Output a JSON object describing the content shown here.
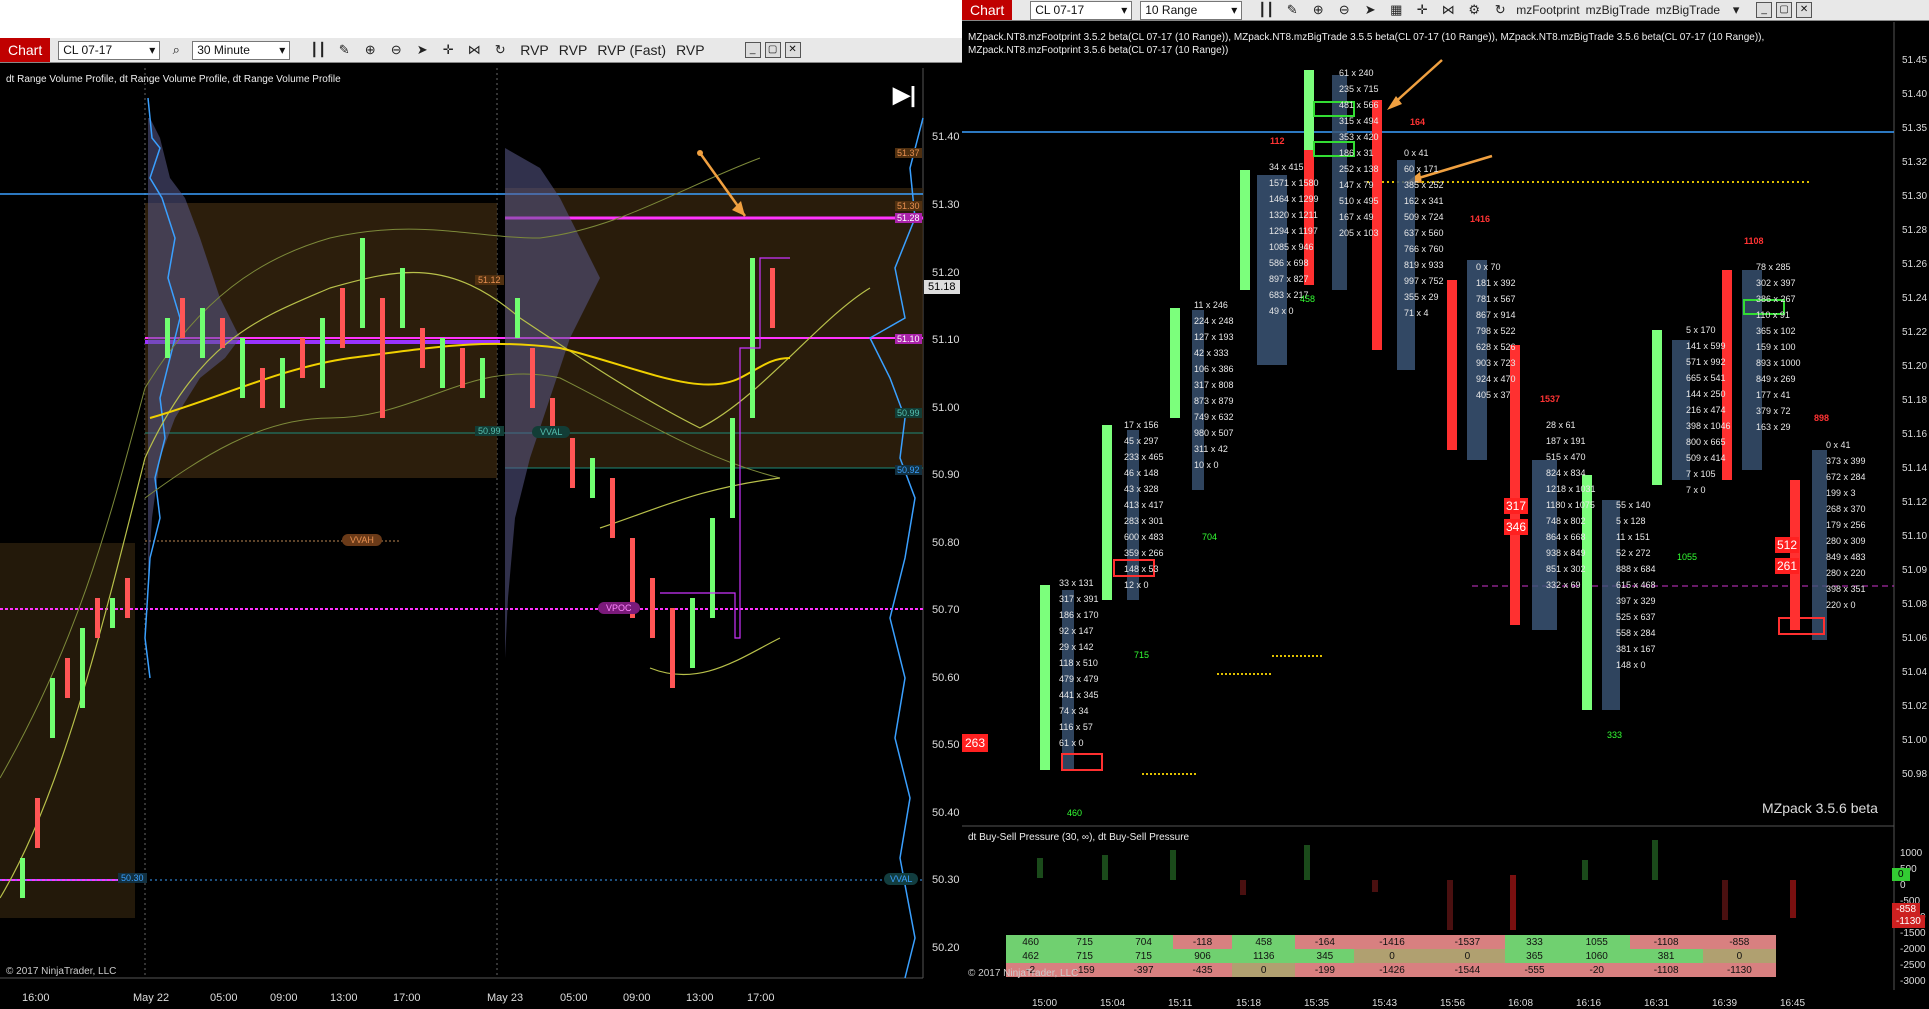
{
  "left": {
    "toolbar": {
      "title": "Chart",
      "instrument": "CL 07-17",
      "interval": "30 Minute",
      "labels": [
        "RVP",
        "RVP",
        "RVP  (Fast)",
        "RVP"
      ]
    },
    "indicator_label": "dt Range Volume Profile, dt Range Volume Profile, dt Range Volume Profile",
    "copyright": "© 2017 NinjaTrader, LLC",
    "price_axis": [
      "51.40",
      "51.30",
      "51.20",
      "51.10",
      "51.00",
      "50.90",
      "50.80",
      "50.70",
      "50.60",
      "50.50",
      "50.40",
      "50.30",
      "50.20"
    ],
    "time_axis": [
      "16:00",
      "May 22",
      "05:00",
      "09:00",
      "13:00",
      "17:00",
      "May 23",
      "05:00",
      "09:00",
      "13:00",
      "17:00"
    ],
    "markers": {
      "vvah": "VVAH",
      "vpoc": "VPOC",
      "vval": "VVAL",
      "vval2": "VVAL",
      "current": "51.18",
      "tag_1137": "51.37",
      "tag_5130": "51.30",
      "tag_5128": "51.28",
      "tag_5110": "51.10",
      "tag_5099": "50.99",
      "tag_5092": "50.92",
      "tag_5099b": "50.99",
      "tag_5030": "50.30",
      "tag_5112": "51.12"
    },
    "colors": {
      "magenta": "#ff33ff",
      "accent_blue": "#3aa0ff",
      "poc_purple": "#9933ff"
    }
  },
  "right": {
    "toolbar": {
      "title": "Chart",
      "instrument": "CL 07-17",
      "interval": "10 Range",
      "labels": [
        "mzFootprint",
        "mzBigTrade",
        "mzBigTrade"
      ]
    },
    "indicator_line1": "MZpack.NT8.mzFootprint 3.5.2 beta(CL 07-17 (10 Range)), MZpack.NT8.mzBigTrade 3.5.5 beta(CL 07-17 (10 Range)), MZpack.NT8.mzBigTrade 3.5.6 beta(CL 07-17 (10 Range)),",
    "indicator_line2": "MZpack.NT8.mzFootprint 3.5.6 beta(CL 07-17 (10 Range))",
    "watermark": "MZpack 3.5.6 beta",
    "sub_label": "dt Buy-Sell Pressure (30, ∞), dt Buy-Sell Pressure",
    "copyright": "© 2017 NinjaTrader, LLC",
    "price_axis": [
      "51.45",
      "51.40",
      "51.35",
      "51.32",
      "51.30",
      "51.28",
      "51.26",
      "51.24",
      "51.22",
      "51.20",
      "51.18",
      "51.16",
      "51.14",
      "51.12",
      "51.10",
      "51.09",
      "51.08",
      "51.06",
      "51.04",
      "51.02",
      "51.00",
      "50.98"
    ],
    "sub_axis": [
      "1000",
      "500",
      "0",
      "-500",
      "-1000",
      "-1500",
      "-2000",
      "-2500",
      "-3000"
    ],
    "sub_tags": {
      "green": "0",
      "red1": "-858",
      "red2": "-1130"
    },
    "time_axis": [
      "15:00",
      "15:04",
      "15:11",
      "15:18",
      "15:35",
      "15:43",
      "15:56",
      "16:08",
      "16:16",
      "16:31",
      "16:39",
      "16:45"
    ],
    "left_badge": "263",
    "delta_row1": [
      "460",
      "715",
      "704",
      "-118",
      "458",
      "-164",
      "-1416",
      "-1537",
      "333",
      "1055",
      "-1108",
      "-858"
    ],
    "delta_row2": [
      "462",
      "715",
      "715",
      "906",
      "1136",
      "345",
      "0",
      "0",
      "365",
      "1060",
      "381",
      "0"
    ],
    "delta_row3": [
      "-2",
      "-159",
      "-397",
      "-435",
      "0",
      "-199",
      "-1426",
      "-1544",
      "-555",
      "-20",
      "-1108",
      "-1130"
    ],
    "bar_deltas": [
      "460",
      "715",
      "704",
      "458",
      "333",
      "1055"
    ],
    "red_deltas": [
      "112",
      "164",
      "1416",
      "1537",
      "1108",
      "898"
    ],
    "big_labels": [
      "317",
      "346",
      "512",
      "261"
    ],
    "columns": [
      {
        "cells": [
          "33 x 131",
          "317 x 391",
          "186 x 170",
          "92 x 147",
          "29 x 142",
          "118 x 510",
          "479 x 479",
          "441 x 345",
          "74 x 34",
          "116 x 57",
          "61 x 0"
        ]
      },
      {
        "cells": [
          "17 x 156",
          "45 x 297",
          "233 x 465",
          "46 x 148",
          "43 x 328",
          "413 x 417",
          "283 x 301",
          "600 x 483",
          "359 x 266",
          "148 x 53",
          "12 x 0"
        ]
      },
      {
        "cells": [
          "11 x 246",
          "224 x 248",
          "127 x 193",
          "42 x 333",
          "106 x 386",
          "317 x 808",
          "873 x 879",
          "749 x 632",
          "980 x 507",
          "311 x 42",
          "10 x 0"
        ]
      },
      {
        "cells": [
          "34 x 415",
          "1571 x 1580",
          "1464 x 1299",
          "1320 x 1211",
          "1294 x 1197",
          "1085 x 946",
          "586 x 698",
          "897 x 827",
          "683 x 217",
          "49 x 0"
        ]
      },
      {
        "cells": [
          "61 x 240",
          "235 x 715",
          "481 x 566",
          "315 x 494",
          "353 x 420",
          "186 x 31",
          "252 x 138",
          "147 x 79",
          "510 x 495",
          "167 x 49",
          "205 x 103"
        ]
      },
      {
        "cells": [
          "0 x 41",
          "60 x 171",
          "385 x 252",
          "162 x 341",
          "509 x 724",
          "637 x 560",
          "766 x 760",
          "819 x 933",
          "997 x 752",
          "355 x 29",
          "71 x 4"
        ]
      },
      {
        "cells": [
          "0 x 70",
          "181 x 392",
          "781 x 567",
          "867 x 914",
          "798 x 522",
          "628 x 526",
          "903 x 723",
          "924 x 470",
          "405 x 37"
        ]
      },
      {
        "cells": [
          "28 x 61",
          "187 x 191",
          "515 x 470",
          "824 x 834",
          "1218 x 1031",
          "1180 x 1075",
          "748 x 802",
          "864 x 668",
          "938 x 849",
          "851 x 302",
          "332 x 69"
        ]
      },
      {
        "cells": [
          "55 x 140",
          "5 x 128",
          "11 x 151",
          "52 x 272",
          "888 x 684",
          "615 x 468",
          "397 x 329",
          "525 x 637",
          "558 x 284",
          "381 x 167",
          "148 x 0"
        ]
      },
      {
        "cells": [
          "5 x 170",
          "141 x 599",
          "571 x 992",
          "665 x 541",
          "144 x 250",
          "216 x 474",
          "398 x 1046",
          "800 x 665",
          "509 x 414",
          "7 x 105",
          "7 x 0"
        ]
      },
      {
        "cells": [
          "78 x 285",
          "302 x 397",
          "386 x 267",
          "110 x 91",
          "365 x 102",
          "159 x 100",
          "893 x 1000",
          "849 x 269",
          "177 x 41",
          "379 x 72",
          "163 x 29"
        ]
      },
      {
        "cells": [
          "0 x 41",
          "373 x 399",
          "672 x 284",
          "199 x 3",
          "268 x 370",
          "179 x 256",
          "280 x 309",
          "849 x 483",
          "280 x 220",
          "398 x 351",
          "220 x 0"
        ]
      }
    ]
  }
}
